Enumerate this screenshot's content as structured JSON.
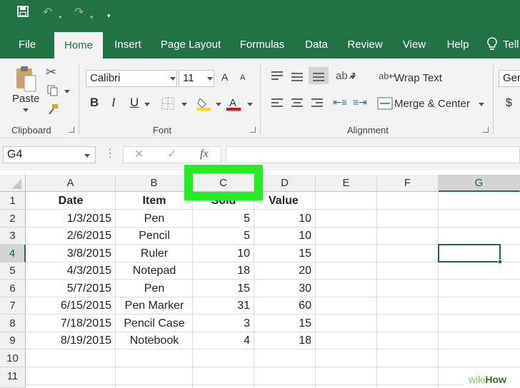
{
  "quick_access": {
    "save_icon": "save-icon",
    "undo_icon": "undo-icon",
    "redo_icon": "redo-icon",
    "customize_icon": "customize-icon"
  },
  "tabs": [
    "File",
    "Home",
    "Insert",
    "Page Layout",
    "Formulas",
    "Data",
    "Review",
    "View",
    "Help",
    "Tell"
  ],
  "active_tab": "Home",
  "ribbon": {
    "clipboard": {
      "label": "Clipboard",
      "paste": "Paste"
    },
    "font": {
      "label": "Font",
      "font_name": "Calibri",
      "font_size": "11",
      "bold": "B",
      "italic": "I",
      "underline": "U",
      "grow": "A",
      "shrink": "A"
    },
    "alignment": {
      "label": "Alignment",
      "wrap_text": "Wrap Text",
      "merge_center": "Merge & Center"
    },
    "number": {
      "format": "Gen",
      "currency": "$"
    }
  },
  "formula_bar": {
    "name_box": "G4",
    "cancel": "✕",
    "enter": "✓",
    "fx": "fx",
    "value": ""
  },
  "columns": [
    "A",
    "B",
    "C",
    "D",
    "E",
    "F",
    "G"
  ],
  "rows": [
    "1",
    "2",
    "3",
    "4",
    "5",
    "6",
    "7",
    "8",
    "9",
    "10",
    "11"
  ],
  "headers": {
    "a": "Date",
    "b": "Item",
    "c": "Sold",
    "d": "Value"
  },
  "table": [
    {
      "date": "1/3/2015",
      "item": "Pen",
      "sold": "5",
      "value": "10"
    },
    {
      "date": "2/6/2015",
      "item": "Pencil",
      "sold": "5",
      "value": "10"
    },
    {
      "date": "3/8/2015",
      "item": "Ruler",
      "sold": "10",
      "value": "15"
    },
    {
      "date": "4/3/2015",
      "item": "Notepad",
      "sold": "18",
      "value": "20"
    },
    {
      "date": "5/7/2015",
      "item": "Pen",
      "sold": "15",
      "value": "30"
    },
    {
      "date": "6/15/2015",
      "item": "Pen Marker",
      "sold": "31",
      "value": "60"
    },
    {
      "date": "7/18/2015",
      "item": "Pencil Case",
      "sold": "3",
      "value": "15"
    },
    {
      "date": "8/19/2015",
      "item": "Notebook",
      "sold": "4",
      "value": "18"
    }
  ],
  "watermark": {
    "wiki": "wiki",
    "how": "How"
  },
  "colors": {
    "excel_green": "#217346",
    "highlight_green": "#22ee22",
    "selection_border": "#1e6b3a"
  }
}
